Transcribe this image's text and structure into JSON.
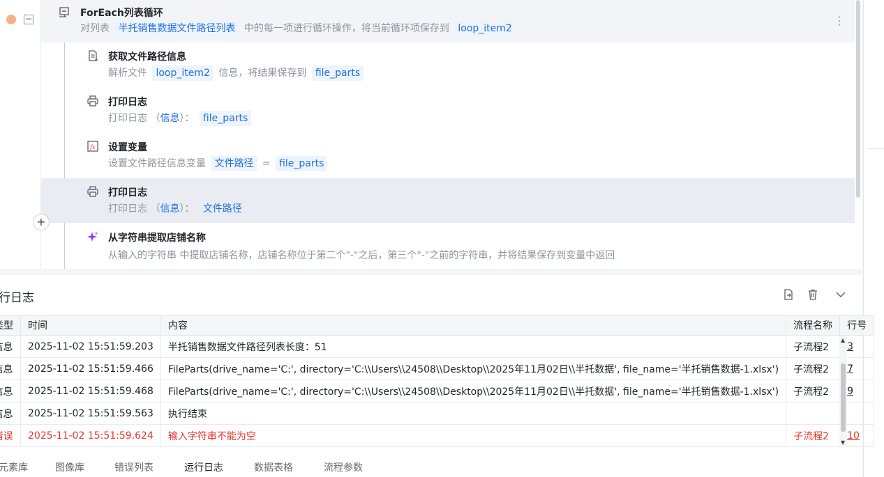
{
  "flow": {
    "loop": {
      "title": "ForEach列表循环",
      "desc_prefix": "对列表",
      "list_var": "半托销售数据文件路径列表",
      "desc_mid": "中的每一项进行循环操作，将当前循环项保存到",
      "item_var": "loop_item2"
    },
    "steps": [
      {
        "icon": "file-info-icon",
        "title": "获取文件路径信息",
        "desc_a": "解析文件",
        "var_a": "loop_item2",
        "desc_b": "信息，将结果保存到",
        "var_b": "file_parts"
      },
      {
        "icon": "printer-icon",
        "title": "打印日志",
        "desc_a": "打印日志",
        "paren_open": "（",
        "level": "信息",
        "paren_close": "）：",
        "var_a": "file_parts"
      },
      {
        "icon": "fx-icon",
        "title": "设置变量",
        "desc_a": "设置文件路径信息变量",
        "var_a": "文件路径",
        "eq": "=",
        "var_b": "file_parts"
      },
      {
        "icon": "printer-icon",
        "title": "打印日志",
        "desc_a": "打印日志",
        "paren_open": "（",
        "level": "信息",
        "paren_close": "）：",
        "var_a": "文件路径"
      },
      {
        "icon": "sparkle-icon",
        "title": "从字符串提取店铺名称",
        "desc_a": "从输入的字符串  中提取店铺名称，店铺名称位于第二个\"-\"之后，第三个\"-\"之前的字符串，并将结果保存到变量中返回"
      }
    ]
  },
  "log": {
    "title": "行日志",
    "columns": [
      "类型",
      "时间",
      "内容",
      "流程名称",
      "行号"
    ],
    "rows": [
      {
        "type": "信息",
        "time": "2025-11-02 15:51:59.203",
        "content": "半托销售数据文件路径列表长度：51",
        "proc": "子流程2",
        "line": "3"
      },
      {
        "type": "信息",
        "time": "2025-11-02 15:51:59.466",
        "content": "FileParts(drive_name='C:', directory='C:\\\\Users\\\\24508\\\\Desktop\\\\2025年11月02日\\\\半托数据', file_name='半托销售数据-1.xlsx')",
        "proc": "子流程2",
        "line": "7"
      },
      {
        "type": "信息",
        "time": "2025-11-02 15:51:59.468",
        "content": "FileParts(drive_name='C:', directory='C:\\\\Users\\\\24508\\\\Desktop\\\\2025年11月02日\\\\半托数据', file_name='半托销售数据-1.xlsx')",
        "proc": "子流程2",
        "line": "9"
      },
      {
        "type": "信息",
        "time": "2025-11-02 15:51:59.563",
        "content": "执行结束",
        "proc": "",
        "line": ""
      },
      {
        "type": "错误",
        "time": "2025-11-02 15:51:59.624",
        "content": " 输入字符串不能为空",
        "proc": "子流程2",
        "line": "10"
      }
    ]
  },
  "tabs": [
    "元素库",
    "图像库",
    "错误列表",
    "运行日志",
    "数据表格",
    "流程参数"
  ],
  "colors": {
    "accent": "#1f6fe0",
    "error": "#e8352b",
    "breakpoint": "#f5b187",
    "highlight": "#e9ecf2"
  }
}
